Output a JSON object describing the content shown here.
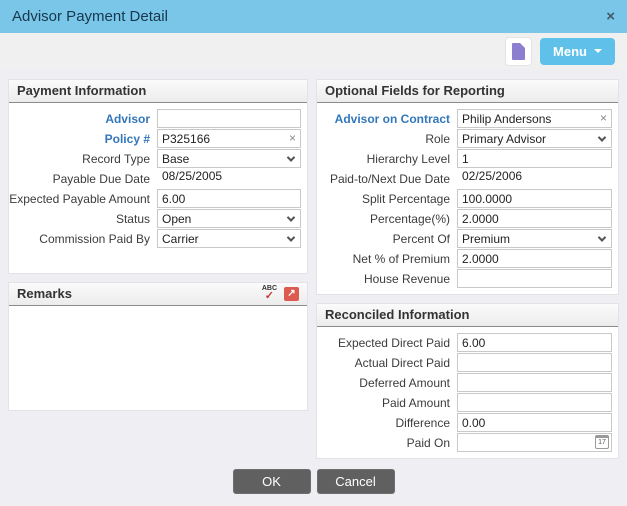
{
  "dialog": {
    "title": "Advisor Payment Detail",
    "close_icon": "×"
  },
  "toolbar": {
    "menu_label": "Menu"
  },
  "icons": {
    "clear": "×",
    "spellcheck_abc": "ABC",
    "spellcheck_check": "✓",
    "popup_arrow": "↗",
    "calendar_day": "17"
  },
  "payment_information": {
    "title": "Payment Information",
    "fields": [
      {
        "label": "Advisor",
        "value": "",
        "type": "input",
        "link": true
      },
      {
        "label": "Policy #",
        "value": "P325166",
        "type": "input-clear",
        "link": true
      },
      {
        "label": "Record Type",
        "value": "Base",
        "type": "select"
      },
      {
        "label": "Payable Due Date",
        "value": "08/25/2005",
        "type": "static"
      },
      {
        "label": "Expected Payable Amount",
        "value": "6.00",
        "type": "input"
      },
      {
        "label": "Status",
        "value": "Open",
        "type": "select"
      },
      {
        "label": "Commission Paid By",
        "value": "Carrier",
        "type": "select"
      }
    ]
  },
  "optional_fields": {
    "title": "Optional Fields for Reporting",
    "fields": [
      {
        "label": "Advisor on Contract",
        "value": "Philip Andersons",
        "type": "input-clear",
        "link": true
      },
      {
        "label": "Role",
        "value": "Primary Advisor",
        "type": "select"
      },
      {
        "label": "Hierarchy Level",
        "value": "1",
        "type": "input"
      },
      {
        "label": "Paid-to/Next Due Date",
        "value": "02/25/2006",
        "type": "static"
      },
      {
        "label": "Split Percentage",
        "value": "100.0000",
        "type": "input"
      },
      {
        "label": "Percentage(%)",
        "value": "2.0000",
        "type": "input"
      },
      {
        "label": "Percent Of",
        "value": "Premium",
        "type": "select"
      },
      {
        "label": "Net % of Premium",
        "value": "2.0000",
        "type": "input"
      },
      {
        "label": "House Revenue",
        "value": "",
        "type": "input"
      }
    ]
  },
  "remarks": {
    "title": "Remarks",
    "value": ""
  },
  "reconciled": {
    "title": "Reconciled Information",
    "fields": [
      {
        "label": "Expected Direct Paid",
        "value": "6.00",
        "type": "input"
      },
      {
        "label": "Actual Direct Paid",
        "value": "",
        "type": "input"
      },
      {
        "label": "Deferred Amount",
        "value": "",
        "type": "input"
      },
      {
        "label": "Paid Amount",
        "value": "",
        "type": "input"
      },
      {
        "label": "Difference",
        "value": "0.00",
        "type": "input"
      },
      {
        "label": "Paid On",
        "value": "",
        "type": "input-calendar"
      }
    ]
  },
  "footer": {
    "ok_label": "OK",
    "cancel_label": "Cancel"
  },
  "colors": {
    "titlebar": "#7AC6E8",
    "menu_button": "#5FC0E9",
    "link_label": "#3377BB",
    "doc_icon_purple": "#8D7FD0",
    "alert_red": "#DC5A50",
    "footer_button": "#606060"
  }
}
